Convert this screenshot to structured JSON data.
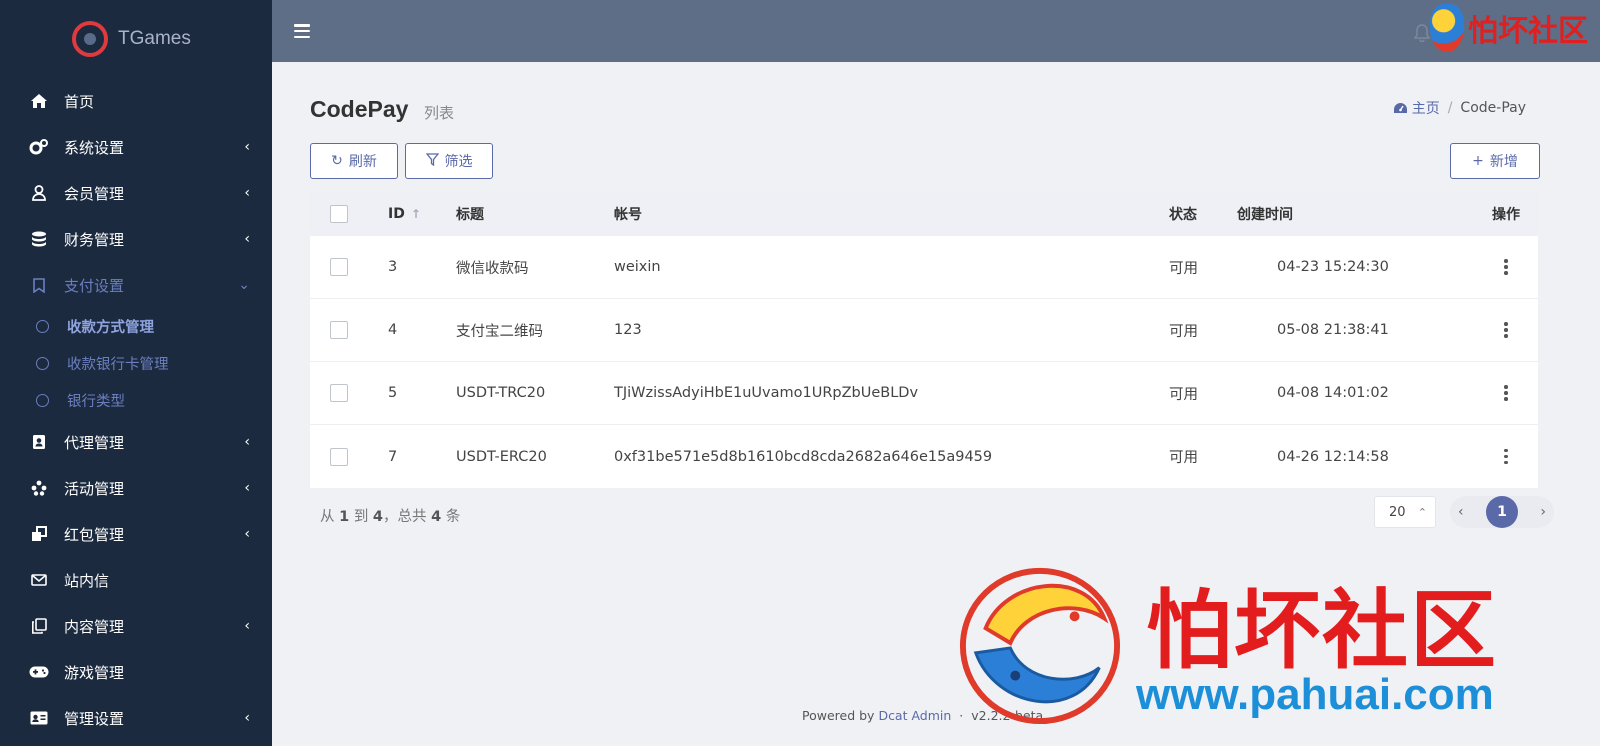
{
  "brand": {
    "name": "TGames"
  },
  "sidebar": {
    "items": [
      {
        "label": "首页",
        "icon": "home-icon",
        "has_arrow": false
      },
      {
        "label": "系统设置",
        "icon": "gears-icon",
        "has_arrow": true
      },
      {
        "label": "会员管理",
        "icon": "user-icon",
        "has_arrow": true
      },
      {
        "label": "财务管理",
        "icon": "database-icon",
        "has_arrow": true
      },
      {
        "label": "支付设置",
        "icon": "bookmark-icon",
        "has_arrow": true,
        "open": true
      },
      {
        "label": "代理管理",
        "icon": "contact-card-icon",
        "has_arrow": true
      },
      {
        "label": "活动管理",
        "icon": "yelp-icon",
        "has_arrow": true
      },
      {
        "label": "红包管理",
        "icon": "clone-icon",
        "has_arrow": true
      },
      {
        "label": "站内信",
        "icon": "envelope-icon",
        "has_arrow": false
      },
      {
        "label": "内容管理",
        "icon": "copy-icon",
        "has_arrow": true
      },
      {
        "label": "游戏管理",
        "icon": "gamepad-icon",
        "has_arrow": false
      },
      {
        "label": "管理设置",
        "icon": "id-card-icon",
        "has_arrow": true
      }
    ],
    "submenu": [
      {
        "label": "收款方式管理",
        "active": true
      },
      {
        "label": "收款银行卡管理",
        "active": false
      },
      {
        "label": "银行类型",
        "active": false
      }
    ]
  },
  "header": {
    "watermark": "怕坏社区"
  },
  "page": {
    "title": "CodePay",
    "subtitle": "列表"
  },
  "breadcrumb": {
    "home": "主页",
    "current": "Code-Pay"
  },
  "toolbar": {
    "refresh": "刷新",
    "filter": "筛选",
    "create": "新增"
  },
  "table": {
    "headers": {
      "id": "ID",
      "title": "标题",
      "account": "帐号",
      "status": "状态",
      "created": "创建时间",
      "ops": "操作"
    },
    "rows": [
      {
        "id": "3",
        "title": "微信收款码",
        "account": "weixin",
        "status": "可用",
        "created": "04-23 15:24:30"
      },
      {
        "id": "4",
        "title": "支付宝二维码",
        "account": "123",
        "status": "可用",
        "created": "05-08 21:38:41"
      },
      {
        "id": "5",
        "title": "USDT-TRC20",
        "account": "TJiWzissAdyiHbE1uUvamo1URpZbUeBLDv",
        "status": "可用",
        "created": "04-08 14:01:02"
      },
      {
        "id": "7",
        "title": "USDT-ERC20",
        "account": "0xf31be571e5d8b1610bcd8cda2682a646e15a9459",
        "status": "可用",
        "created": "04-26 12:14:58"
      }
    ]
  },
  "pagination": {
    "from_label": "从",
    "from": "1",
    "to_label": "到",
    "to": "4",
    "total_label": "，总共",
    "total": "4",
    "unit": "条",
    "per_page": "20",
    "current_page": "1"
  },
  "footer": {
    "powered": "Powered by",
    "product": "Dcat Admin",
    "sep": "·",
    "version": "v2.2.2-beta"
  },
  "watermark": {
    "cn": "怕坏社区",
    "url": "www.pahuai.com"
  },
  "colors": {
    "sidebar_bg": "#1b2a3e",
    "topbar_bg": "#5f6e87",
    "accent": "#5a6aa8",
    "watermark_red": "#e31d1d",
    "watermark_blue": "#1c8fd8"
  }
}
